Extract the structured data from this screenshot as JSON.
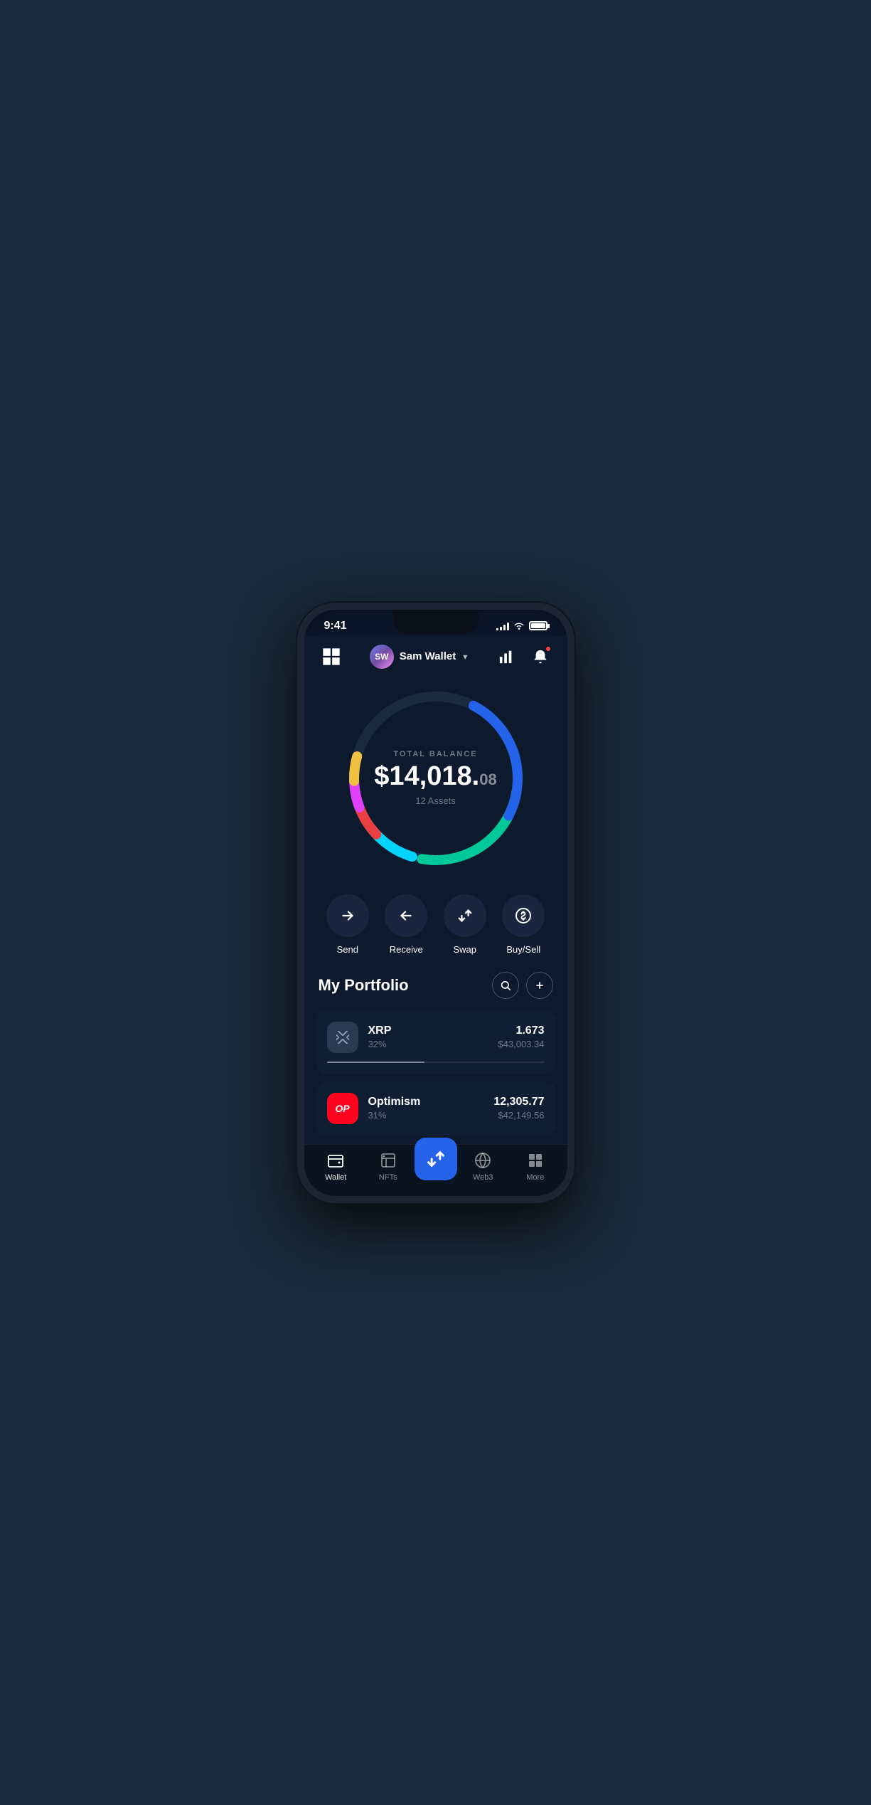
{
  "statusBar": {
    "time": "9:41",
    "signalBars": [
      3,
      5,
      8,
      11
    ],
    "batteryLevel": "100%"
  },
  "header": {
    "userInitials": "SW",
    "userName": "Sam Wallet",
    "qrIconLabel": "qr-scan",
    "chartIconLabel": "portfolio-chart",
    "notificationIconLabel": "notifications"
  },
  "balance": {
    "label": "TOTAL BALANCE",
    "main": "$14,018.",
    "cents": "08",
    "assetsCount": "12 Assets"
  },
  "actions": [
    {
      "id": "send",
      "label": "Send",
      "icon": "→"
    },
    {
      "id": "receive",
      "label": "Receive",
      "icon": "←"
    },
    {
      "id": "swap",
      "label": "Swap",
      "icon": "⇅"
    },
    {
      "id": "buysell",
      "label": "Buy/Sell",
      "icon": "$"
    }
  ],
  "portfolio": {
    "title": "My Portfolio",
    "searchLabel": "🔍",
    "addLabel": "+",
    "assets": [
      {
        "id": "xrp",
        "name": "XRP",
        "percent": "32%",
        "amount": "1.673",
        "usd": "$43,003.34",
        "barWidth": "45%"
      },
      {
        "id": "optimism",
        "name": "Optimism",
        "percent": "31%",
        "amount": "12,305.77",
        "usd": "$42,149.56",
        "barWidth": "44%"
      }
    ]
  },
  "bottomNav": {
    "items": [
      {
        "id": "wallet",
        "label": "Wallet",
        "icon": "wallet"
      },
      {
        "id": "nfts",
        "label": "NFTs",
        "icon": "nfts"
      },
      {
        "id": "swap-center",
        "label": "",
        "icon": "swap-center"
      },
      {
        "id": "web3",
        "label": "Web3",
        "icon": "web3"
      },
      {
        "id": "more",
        "label": "More",
        "icon": "more"
      }
    ]
  },
  "colors": {
    "background": "#0d1a2e",
    "card": "#0f1e33",
    "accent": "#2563eb",
    "navBg": "#0a1420"
  }
}
